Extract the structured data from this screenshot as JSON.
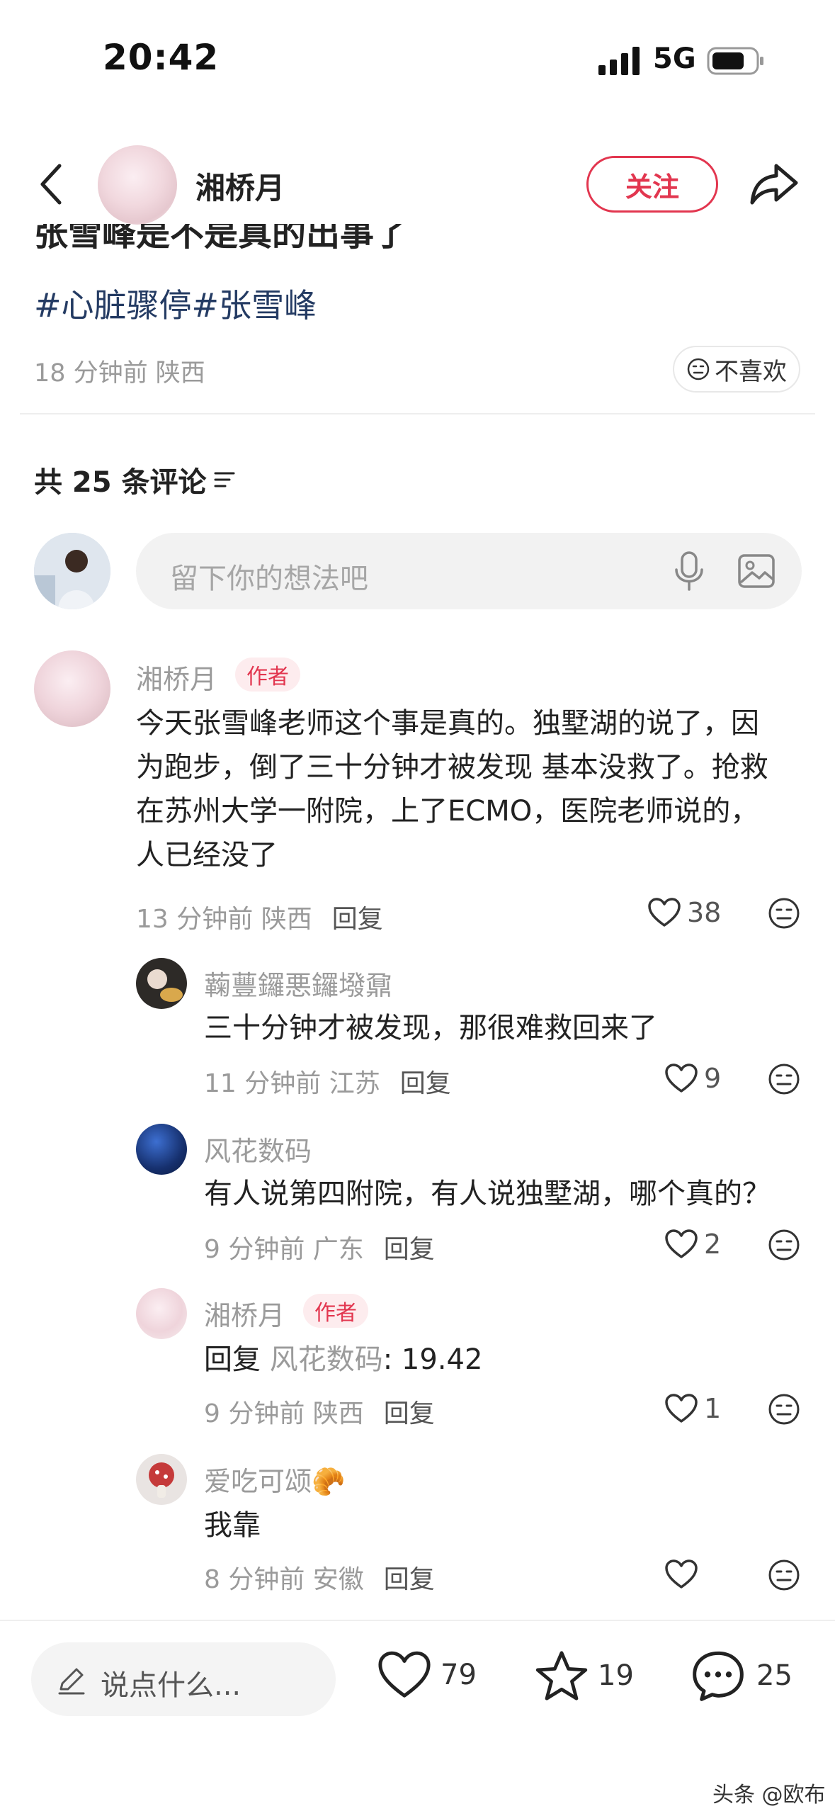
{
  "status_bar": {
    "time": "20:42",
    "network": "5G"
  },
  "header": {
    "username": "湘桥月",
    "follow_label": "关注"
  },
  "post": {
    "title_partial": "张雪峰是不是真的出事了",
    "tags": [
      "#心脏骤停",
      "#张雪峰"
    ],
    "meta": "18 分钟前 陕西",
    "dislike_label": "不喜欢"
  },
  "comments_header": {
    "label": "共 25 条评论"
  },
  "input": {
    "placeholder": "留下你的想法吧"
  },
  "comments": {
    "main": {
      "author": "湘桥月",
      "badge": "作者",
      "lines": [
        "今天张雪峰老师这个事是真的。独墅湖的说了，因",
        "为跑步，倒了三十分钟才被发现 基本没救了。抢救",
        "在苏州大学一附院，上了ECMO，医院老师说的，",
        "人已经没了"
      ],
      "time": "13 分钟前 陕西",
      "reply_label": "回复",
      "likes": "38"
    },
    "replies": [
      {
        "author": "蘜蘴鑼悪鑼墢鼐",
        "text": "三十分钟才被发现，那很难救回来了",
        "time": "11 分钟前 江苏",
        "reply_label": "回复",
        "likes": "9"
      },
      {
        "author": "风花数码",
        "text": "有人说第四附院，有人说独墅湖，哪个真的？",
        "time": "9 分钟前 广东",
        "reply_label": "回复",
        "likes": "2"
      },
      {
        "author": "湘桥月",
        "badge": "作者",
        "reply_prefix": "回复",
        "reply_to": "风花数码",
        "text": ": 19.42",
        "time": "9 分钟前 陕西",
        "reply_label": "回复",
        "likes": "1"
      },
      {
        "author": "爱吃可颂🥐",
        "text": "我靠",
        "time": "8 分钟前 安徽",
        "reply_label": "回复",
        "likes": ""
      }
    ]
  },
  "bottom_bar": {
    "say_placeholder": "说点什么...",
    "likes": "79",
    "favorites": "19",
    "comments": "25"
  },
  "watermark": "头条 @欧布",
  "colors": {
    "accent": "#e2364f",
    "tag": "#243b63",
    "meta": "#9a9a9a"
  }
}
